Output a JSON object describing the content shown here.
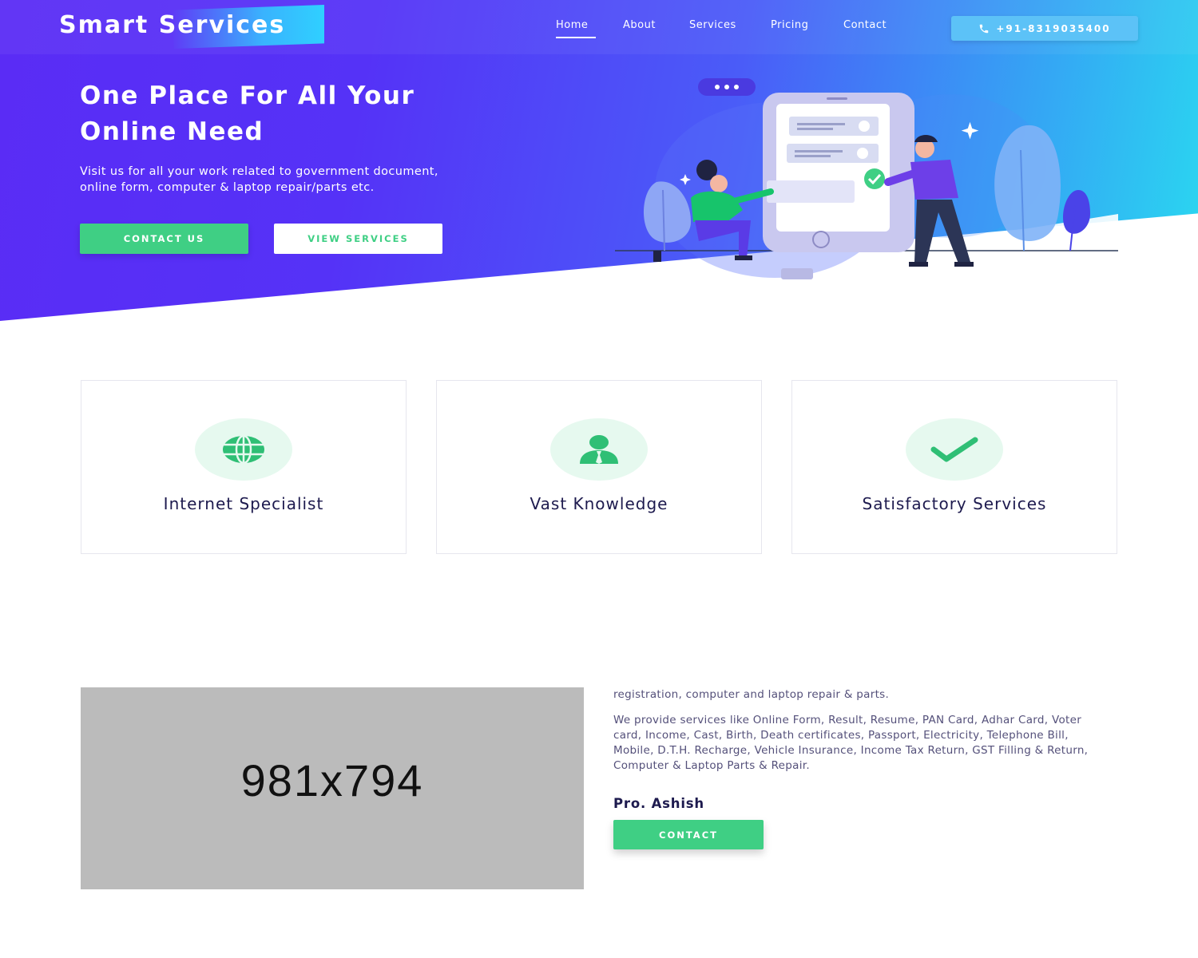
{
  "brand": {
    "name": "Smart Services"
  },
  "nav": {
    "items": [
      "Home",
      "About",
      "Services",
      "Pricing",
      "Contact"
    ],
    "active": "Home",
    "phone": "+91-8319035400"
  },
  "hero": {
    "title_line1": "One Place For All Your",
    "title_line2": "Online Need",
    "subtitle_line1": "Visit us for all your work related to government document,",
    "subtitle_line2": "online form, computer & laptop repair/parts etc.",
    "primary_button": "CONTACT US",
    "secondary_button": "VIEW SERVICES"
  },
  "features": [
    {
      "title": "Internet Specialist",
      "icon": "globe-icon"
    },
    {
      "title": "Vast Knowledge",
      "icon": "user-tie-icon"
    },
    {
      "title": "Satisfactory Services",
      "icon": "check-icon"
    }
  ],
  "about": {
    "image_placeholder": "981x794",
    "line1": "registration, computer and laptop repair & parts.",
    "paragraph": "We provide services like Online Form, Result, Resume, PAN Card, Adhar Card, Voter card, Income, Cast, Birth, Death certificates, Passport, Electricity, Telephone Bill, Mobile, D.T.H. Recharge, Vehicle Insurance, Income Tax Return, GST Filling & Return, Computer & Laptop Parts & Repair.",
    "author": "Pro. Ashish",
    "button": "CONTACT"
  },
  "colors": {
    "accent_green": "#3fcf84",
    "hero_start": "#5a2cf5",
    "hero_end": "#2ad8f0",
    "heading": "#1d1a4e"
  }
}
